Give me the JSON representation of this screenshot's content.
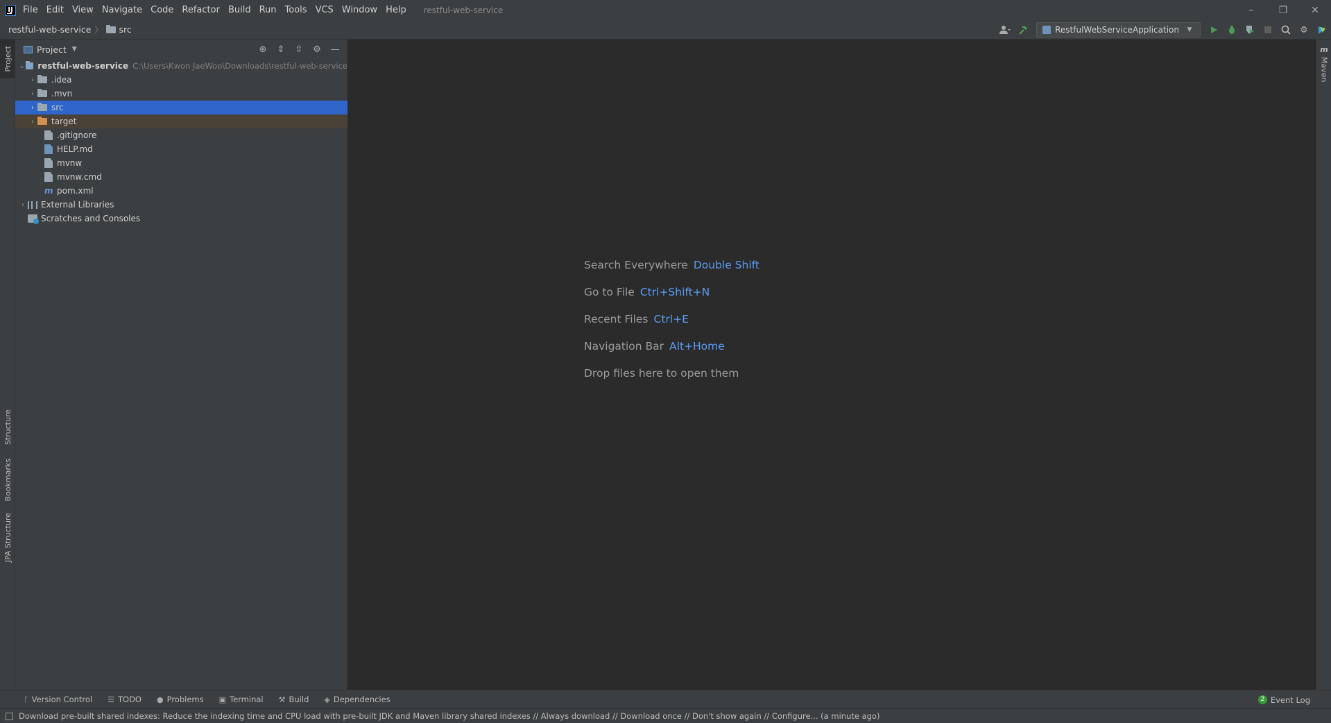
{
  "titlebar": {
    "logo": "IJ",
    "menu": [
      "File",
      "Edit",
      "View",
      "Navigate",
      "Code",
      "Refactor",
      "Build",
      "Run",
      "Tools",
      "VCS",
      "Window",
      "Help"
    ],
    "window_title": "restful-web-service",
    "controls": {
      "minimize": "–",
      "restore": "❐",
      "close": "✕"
    }
  },
  "navbar": {
    "root": "restful-web-service",
    "separator": "〉",
    "current": "src",
    "run_config": "RestfulWebServiceApplication",
    "icons": [
      "user-icon",
      "hammer-icon",
      "run-icon",
      "debug-icon",
      "coverage-icon",
      "stop-icon",
      "search-icon",
      "gear-icon",
      "toolbox-icon"
    ]
  },
  "left_strip": {
    "tabs": [
      "Project",
      "Structure",
      "Bookmarks",
      "JPA Structure"
    ]
  },
  "right_strip": {
    "maven_icon": "m",
    "maven_label": "Maven"
  },
  "project_panel": {
    "title": "Project",
    "tree": {
      "root_name": "restful-web-service",
      "root_path": "C:\\Users\\Kwon JaeWoo\\Downloads\\restful-web-service",
      "idea": ".idea",
      "mvn": ".mvn",
      "src": "src",
      "target": "target",
      "gitignore": ".gitignore",
      "help": "HELP.md",
      "mvnw": "mvnw",
      "mvnw_cmd": "mvnw.cmd",
      "pom": "pom.xml",
      "external_libraries": "External Libraries",
      "scratches": "Scratches and Consoles"
    },
    "colors": {
      "selected": "#2f65ca",
      "excluded": "#4b4237",
      "excluded_folder": "#d18f52"
    }
  },
  "editor": {
    "hints": [
      {
        "label": "Search Everywhere",
        "key": "Double Shift"
      },
      {
        "label": "Go to File",
        "key": "Ctrl+Shift+N"
      },
      {
        "label": "Recent Files",
        "key": "Ctrl+E"
      },
      {
        "label": "Navigation Bar",
        "key": "Alt+Home"
      }
    ],
    "drop_hint": "Drop files here to open them",
    "key_color": "#5b9bf2"
  },
  "bottom_tools": {
    "items": [
      "Version Control",
      "TODO",
      "Problems",
      "Terminal",
      "Build",
      "Dependencies"
    ],
    "event_log": "Event Log",
    "event_count": "2"
  },
  "statusbar": {
    "text": "Download pre-built shared indexes: Reduce the indexing time and CPU load with pre-built JDK and Maven library shared indexes // Always download // Download once // Don't show again // Configure... (a minute ago)"
  }
}
